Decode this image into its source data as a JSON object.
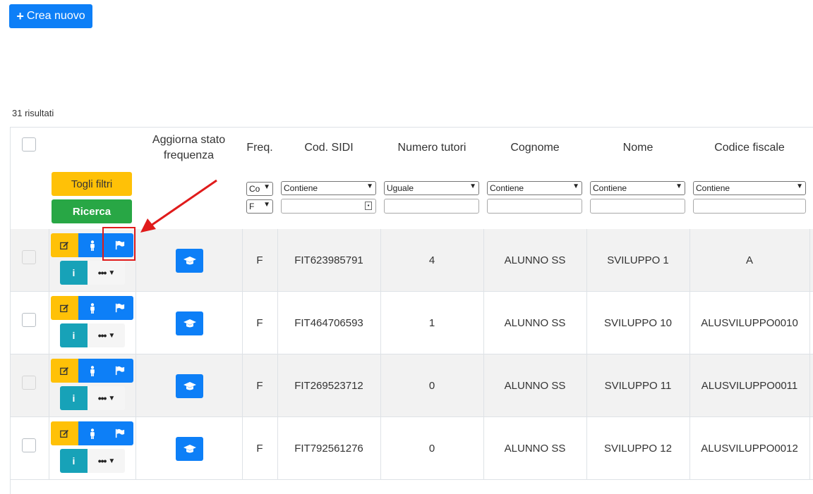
{
  "toolbar": {
    "create_label": "Crea nuovo"
  },
  "results_count": "31 risultati",
  "header": {
    "columns": [
      {
        "key": "aggiorna",
        "label": "Aggiorna stato\nfrequenza"
      },
      {
        "key": "freq",
        "label": "Freq."
      },
      {
        "key": "sidi",
        "label": "Cod. SIDI"
      },
      {
        "key": "tutori",
        "label": "Numero tutori"
      },
      {
        "key": "cognome",
        "label": "Cognome"
      },
      {
        "key": "nome",
        "label": "Nome"
      },
      {
        "key": "cf",
        "label": "Codice fiscale"
      }
    ],
    "togli_filtri": "Togli filtri",
    "ricerca": "Ricerca"
  },
  "filters": {
    "freq_op": "Co",
    "freq_val": "F",
    "sidi_op": "Contiene",
    "tutori_op": "Uguale",
    "cognome_op": "Contiene",
    "nome_op": "Contiene",
    "cf_op": "Contiene"
  },
  "action_icons": {
    "edit": "edit-icon",
    "person": "person-icon",
    "flag": "flag-icon",
    "info_label": "i",
    "more_label": "•••",
    "freq": "graduation-cap-icon"
  },
  "rows": [
    {
      "freq": "F",
      "sidi": "FIT623985791",
      "tutori": "4",
      "cognome": "ALUNNO SS",
      "nome": "SVILUPPO 1",
      "cf": "A"
    },
    {
      "freq": "F",
      "sidi": "FIT464706593",
      "tutori": "1",
      "cognome": "ALUNNO SS",
      "nome": "SVILUPPO 10",
      "cf": "ALUSVILUPPO0010"
    },
    {
      "freq": "F",
      "sidi": "FIT269523712",
      "tutori": "0",
      "cognome": "ALUNNO SS",
      "nome": "SVILUPPO 11",
      "cf": "ALUSVILUPPO0011"
    },
    {
      "freq": "F",
      "sidi": "FIT792561276",
      "tutori": "0",
      "cognome": "ALUNNO SS",
      "nome": "SVILUPPO 12",
      "cf": "ALUSVILUPPO0012"
    }
  ],
  "colors": {
    "primary": "#0d7ff7",
    "warning": "#ffc107",
    "success": "#28a745",
    "info": "#17a2b8",
    "annotation": "#e01b1b"
  }
}
